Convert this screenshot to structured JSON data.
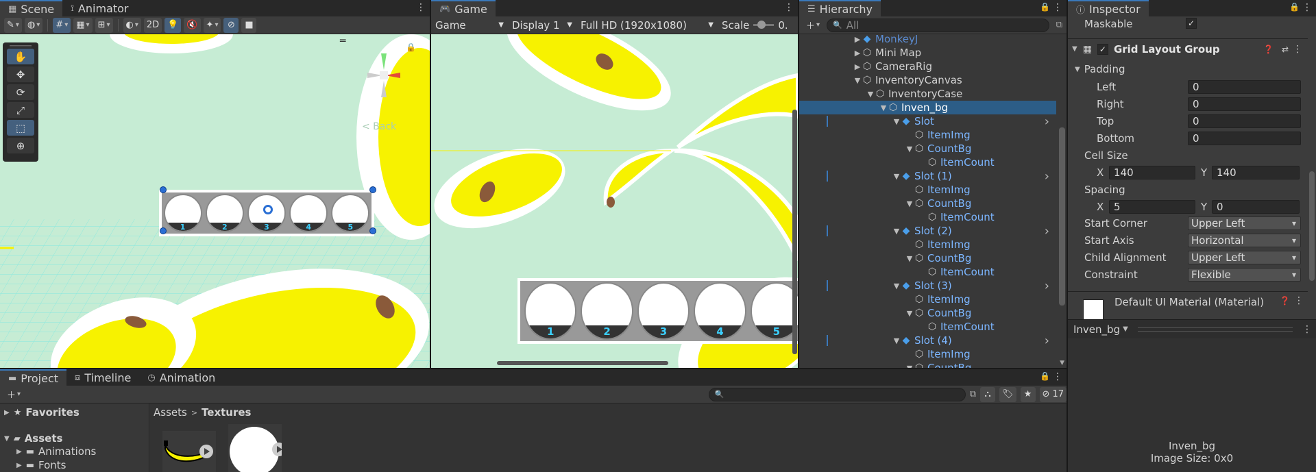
{
  "scene": {
    "tabs": [
      {
        "label": "Scene",
        "icon": "grid-icon"
      },
      {
        "label": "Animator",
        "icon": "animator-icon"
      }
    ],
    "toolbar": {
      "mode_2d": "2D"
    },
    "back_label": "< Back",
    "slots": [
      "1",
      "2",
      "3",
      "4",
      "5"
    ]
  },
  "game": {
    "tab": "Game",
    "toolbar": {
      "mode": "Game",
      "display": "Display 1",
      "resolution": "Full HD (1920x1080)",
      "scale_label": "Scale",
      "scale_value": "0."
    },
    "slots": [
      "1",
      "2",
      "3",
      "4",
      "5"
    ]
  },
  "hierarchy": {
    "tab": "Hierarchy",
    "search_placeholder": "All",
    "items": [
      {
        "label": "MonkeyJ",
        "indent": 0,
        "arrow": "▶",
        "color": "#5b8bd0",
        "prefab": true
      },
      {
        "label": "Mini Map",
        "indent": 0,
        "arrow": "▶",
        "color": "#d2d2d2"
      },
      {
        "label": "CameraRig",
        "indent": 0,
        "arrow": "▶",
        "color": "#d2d2d2"
      },
      {
        "label": "InventoryCanvas",
        "indent": 0,
        "arrow": "▼",
        "color": "#d2d2d2"
      },
      {
        "label": "InventoryCase",
        "indent": 1,
        "arrow": "▼",
        "color": "#d2d2d2"
      },
      {
        "label": "Inven_bg",
        "indent": 2,
        "arrow": "▼",
        "color": "#ffffff",
        "selected": true
      },
      {
        "label": "Slot",
        "indent": 3,
        "arrow": "▼",
        "color": "#7cb6ff",
        "prefab": true,
        "more": true
      },
      {
        "label": "ItemImg",
        "indent": 4,
        "arrow": "",
        "color": "#7cb6ff"
      },
      {
        "label": "CountBg",
        "indent": 4,
        "arrow": "▼",
        "color": "#7cb6ff"
      },
      {
        "label": "ItemCount",
        "indent": 5,
        "arrow": "",
        "color": "#7cb6ff"
      },
      {
        "label": "Slot (1)",
        "indent": 3,
        "arrow": "▼",
        "color": "#7cb6ff",
        "prefab": true,
        "more": true
      },
      {
        "label": "ItemImg",
        "indent": 4,
        "arrow": "",
        "color": "#7cb6ff"
      },
      {
        "label": "CountBg",
        "indent": 4,
        "arrow": "▼",
        "color": "#7cb6ff"
      },
      {
        "label": "ItemCount",
        "indent": 5,
        "arrow": "",
        "color": "#7cb6ff"
      },
      {
        "label": "Slot (2)",
        "indent": 3,
        "arrow": "▼",
        "color": "#7cb6ff",
        "prefab": true,
        "more": true
      },
      {
        "label": "ItemImg",
        "indent": 4,
        "arrow": "",
        "color": "#7cb6ff"
      },
      {
        "label": "CountBg",
        "indent": 4,
        "arrow": "▼",
        "color": "#7cb6ff"
      },
      {
        "label": "ItemCount",
        "indent": 5,
        "arrow": "",
        "color": "#7cb6ff"
      },
      {
        "label": "Slot (3)",
        "indent": 3,
        "arrow": "▼",
        "color": "#7cb6ff",
        "prefab": true,
        "more": true
      },
      {
        "label": "ItemImg",
        "indent": 4,
        "arrow": "",
        "color": "#7cb6ff"
      },
      {
        "label": "CountBg",
        "indent": 4,
        "arrow": "▼",
        "color": "#7cb6ff"
      },
      {
        "label": "ItemCount",
        "indent": 5,
        "arrow": "",
        "color": "#7cb6ff"
      },
      {
        "label": "Slot (4)",
        "indent": 3,
        "arrow": "▼",
        "color": "#7cb6ff",
        "prefab": true,
        "more": true
      },
      {
        "label": "ItemImg",
        "indent": 4,
        "arrow": "",
        "color": "#7cb6ff"
      },
      {
        "label": "CountBg",
        "indent": 4,
        "arrow": "▼",
        "color": "#7cb6ff"
      }
    ]
  },
  "inspector": {
    "tab": "Inspector",
    "maskable_label": "Maskable",
    "component_title": "Grid Layout Group",
    "padding_label": "Padding",
    "padding": [
      {
        "label": "Left",
        "value": "0"
      },
      {
        "label": "Right",
        "value": "0"
      },
      {
        "label": "Top",
        "value": "0"
      },
      {
        "label": "Bottom",
        "value": "0"
      }
    ],
    "cell_size_label": "Cell Size",
    "cell_size": {
      "x": "140",
      "y": "140"
    },
    "spacing_label": "Spacing",
    "spacing": {
      "x": "5",
      "y": "0"
    },
    "axis_x": "X",
    "axis_y": "Y",
    "dropdowns": [
      {
        "label": "Start Corner",
        "value": "Upper Left"
      },
      {
        "label": "Start Axis",
        "value": "Horizontal"
      },
      {
        "label": "Child Alignment",
        "value": "Upper Left"
      },
      {
        "label": "Constraint",
        "value": "Flexible"
      }
    ],
    "material_label": "Default UI Material (Material)",
    "preview_object": "Inven_bg",
    "preview_name": "Inven_bg",
    "preview_size": "Image Size: 0x0"
  },
  "project": {
    "tabs": [
      {
        "label": "Project",
        "icon": "folder-icon"
      },
      {
        "label": "Timeline",
        "icon": "timeline-icon"
      },
      {
        "label": "Animation",
        "icon": "animation-icon"
      }
    ],
    "hidden_count": "17",
    "favorites": "Favorites",
    "assets": "Assets",
    "folders": [
      "Animations",
      "Fonts"
    ],
    "breadcrumb": [
      "Assets",
      "Textures"
    ]
  },
  "colors": {
    "selection": "#2c5d87",
    "accent": "#3a79bb",
    "link": "#7cb6ff",
    "banana": "#f7f200",
    "background_green": "#c6ecd4"
  }
}
